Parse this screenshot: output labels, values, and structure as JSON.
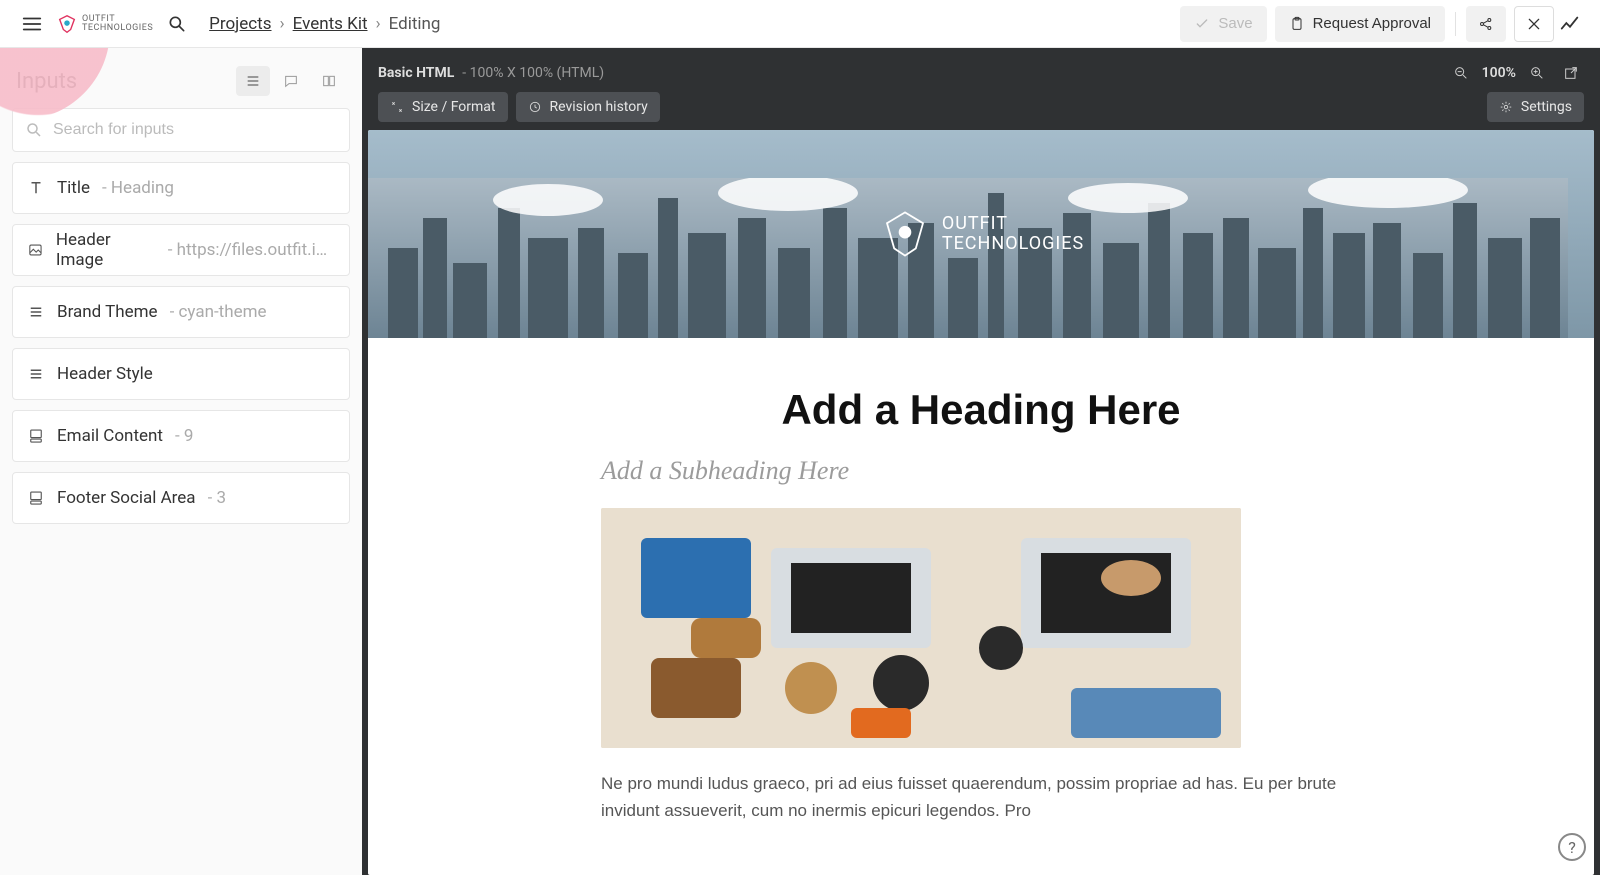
{
  "brand": {
    "name_line1": "OUTFIT",
    "name_line2": "TECHNOLOGIES"
  },
  "breadcrumb": {
    "projects": "Projects",
    "kit": "Events Kit",
    "current": "Editing"
  },
  "topbar": {
    "save": "Save",
    "request_approval": "Request Approval"
  },
  "sidebar": {
    "title": "Inputs",
    "search_placeholder": "Search for inputs",
    "items": [
      {
        "label": "Title",
        "value": "Heading"
      },
      {
        "label": "Header Image",
        "value": "https://files.outfit.io/..."
      },
      {
        "label": "Brand Theme",
        "value": "cyan-theme"
      },
      {
        "label": "Header Style",
        "value": ""
      },
      {
        "label": "Email Content",
        "value": "9"
      },
      {
        "label": "Footer Social Area",
        "value": "3"
      }
    ]
  },
  "preview": {
    "title": "Basic HTML",
    "dimensions": "100% X 100% (HTML)",
    "zoom": "100%",
    "size_format": "Size / Format",
    "revision_history": "Revision history",
    "settings": "Settings"
  },
  "document": {
    "brand_line1": "OUTFIT",
    "brand_line2": "TECHNOLOGIES",
    "heading": "Add a Heading Here",
    "subheading": "Add a Subheading Here",
    "paragraph": "Ne pro mundi ludus graeco, pri ad eius fuisset quaerendum, possim propriae ad has. Eu per brute invidunt assueverit, cum no inermis epicuri legendos. Pro"
  }
}
